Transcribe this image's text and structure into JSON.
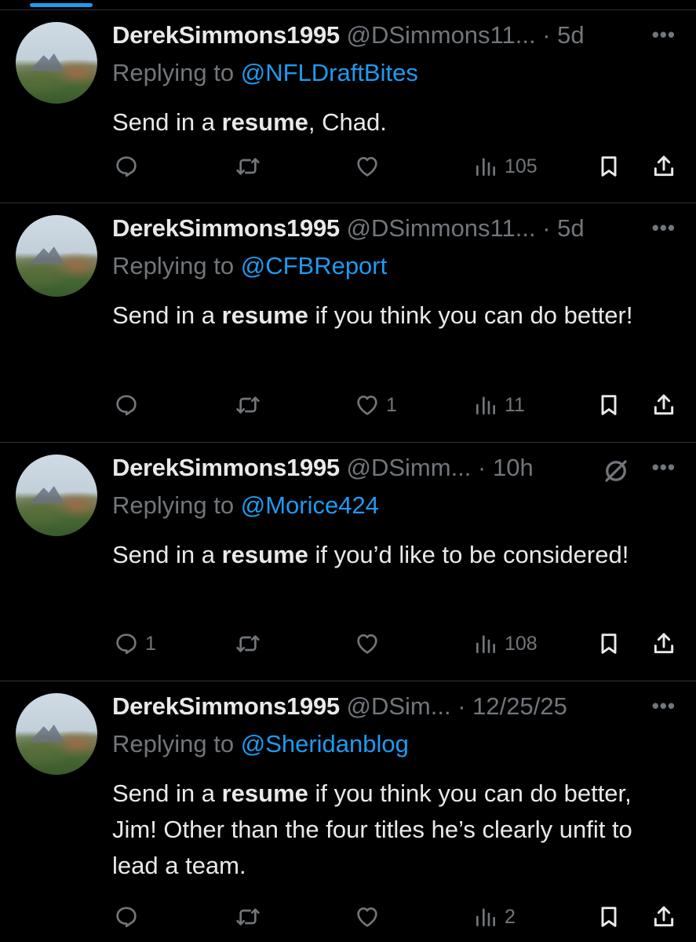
{
  "colors": {
    "background": "#000000",
    "accent": "#1d9bf0",
    "muted": "#71767b",
    "text": "#e7e9ea",
    "divider": "#2f3336"
  },
  "tweets": [
    {
      "name": "DerekSimmons1995",
      "handle": "@DSimmons11...",
      "separator": "·",
      "time": "5d",
      "reply_prefix": "Replying to ",
      "reply_to": "@NFLDraftBites",
      "text_before": "Send in a ",
      "text_bold": "resume",
      "text_after": ", Chad.",
      "muted": false,
      "counts": {
        "replies": "",
        "retweets": "",
        "likes": "",
        "views": "105"
      }
    },
    {
      "name": "DerekSimmons1995",
      "handle": "@DSimmons11...",
      "separator": "·",
      "time": "5d",
      "reply_prefix": "Replying to ",
      "reply_to": "@CFBReport",
      "text_before": "Send in a ",
      "text_bold": "resume",
      "text_after": " if you think you can do better!",
      "muted": false,
      "counts": {
        "replies": "",
        "retweets": "",
        "likes": "1",
        "views": "11"
      }
    },
    {
      "name": "DerekSimmons1995",
      "handle": "@DSimm...",
      "separator": "·",
      "time": "10h",
      "reply_prefix": "Replying to ",
      "reply_to": "@Morice424",
      "text_before": "Send in a ",
      "text_bold": "resume",
      "text_after": " if you’d like to be considered!",
      "muted": true,
      "counts": {
        "replies": "1",
        "retweets": "",
        "likes": "",
        "views": "108"
      }
    },
    {
      "name": "DerekSimmons1995",
      "handle": "@DSim...",
      "separator": "·",
      "time": "12/25/25",
      "reply_prefix": "Replying to ",
      "reply_to": "@Sheridanblog",
      "text_before": "Send in a ",
      "text_bold": "resume",
      "text_after": " if you think you can do better, Jim! Other than the four titles he’s clearly unfit to lead a team.",
      "muted": false,
      "counts": {
        "replies": "",
        "retweets": "",
        "likes": "",
        "views": "2"
      }
    }
  ],
  "icons": {
    "reply": "reply-icon",
    "retweet": "retweet-icon",
    "like": "heart-icon",
    "views": "views-icon",
    "bookmark": "bookmark-icon",
    "share": "share-icon",
    "more": "more-icon",
    "mute": "mute-icon"
  }
}
